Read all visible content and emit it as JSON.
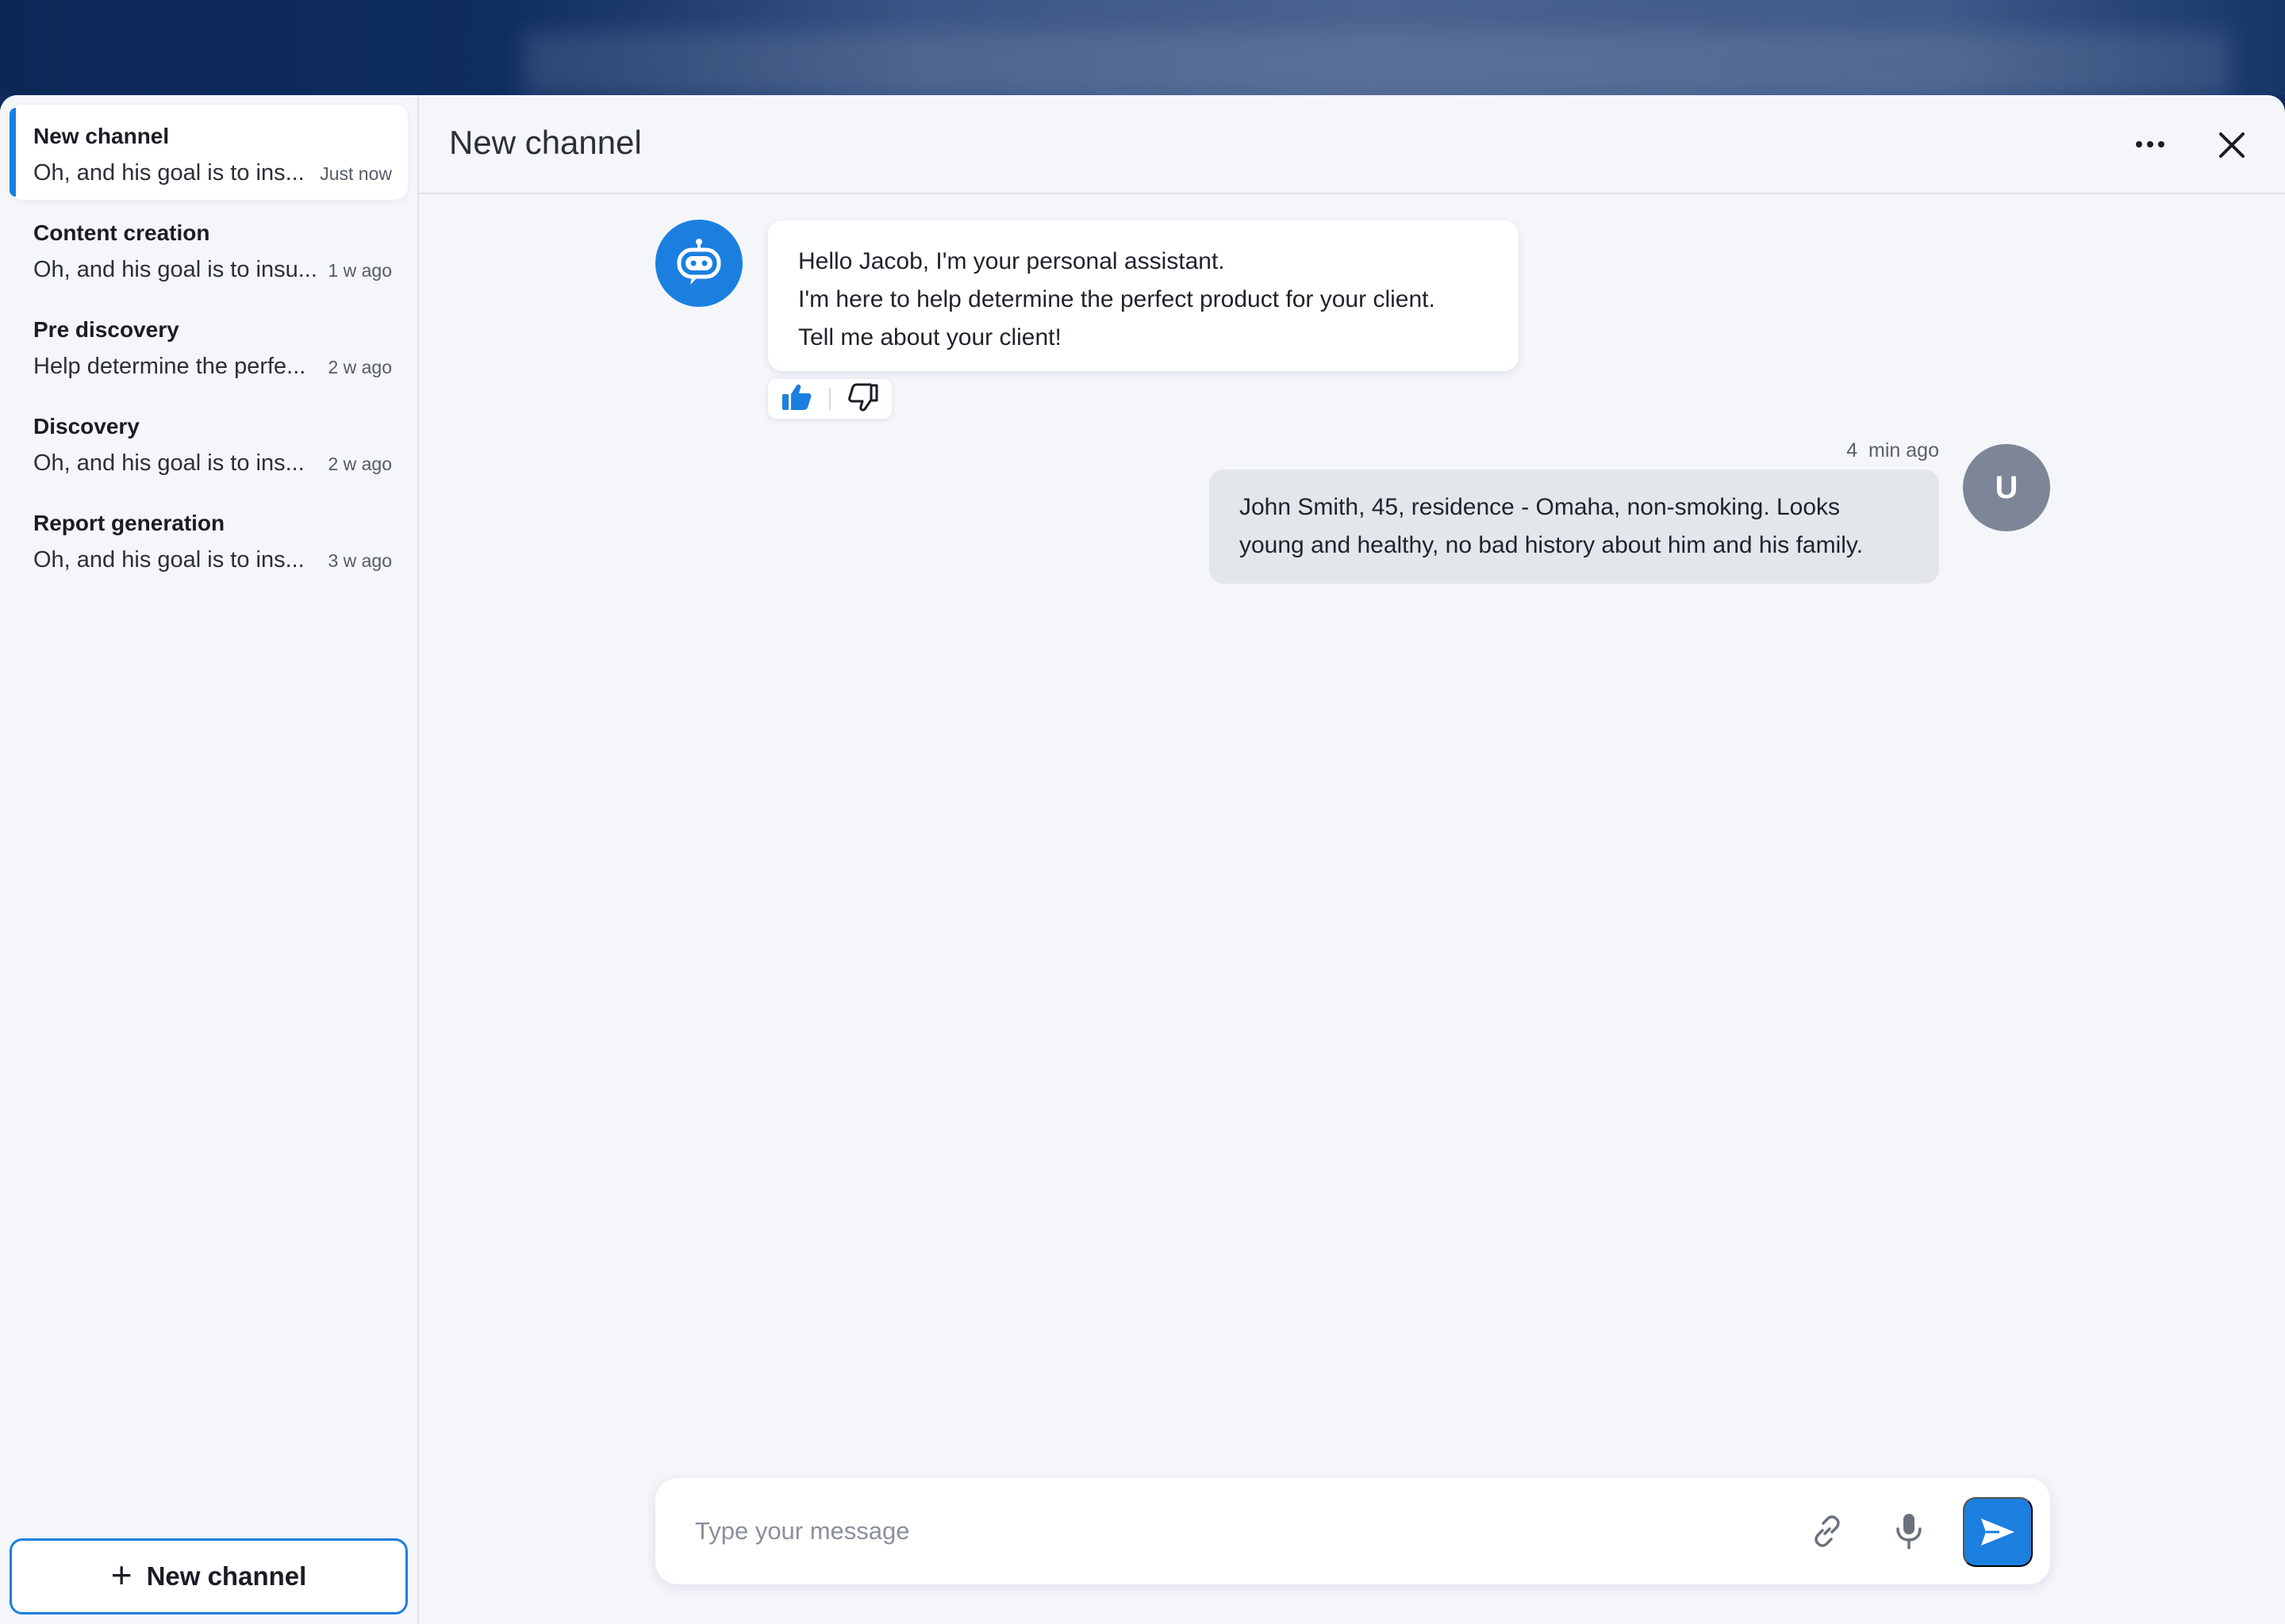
{
  "sidebar": {
    "conversations": [
      {
        "title": "New channel",
        "preview": "Oh, and his goal is to ins...",
        "time": "Just now"
      },
      {
        "title": "Content creation",
        "preview": "Oh, and his goal is to insu...",
        "time": "1 w ago"
      },
      {
        "title": "Pre discovery",
        "preview": "Help determine the perfe...",
        "time": "2 w ago"
      },
      {
        "title": "Discovery",
        "preview": "Oh, and his goal is to ins...",
        "time": "2 w ago"
      },
      {
        "title": "Report generation",
        "preview": "Oh, and his goal is to ins...",
        "time": "3 w ago"
      }
    ],
    "new_channel_label": "New channel"
  },
  "header": {
    "title": "New channel"
  },
  "messages": {
    "bot": {
      "lines": [
        "Hello Jacob, I'm your personal assistant.",
        "I'm here to help determine the perfect product for your client.",
        "Tell me about your client!"
      ]
    },
    "user": {
      "time": "4  min ago",
      "text": "John Smith, 45, residence - Omaha, non-smoking. Looks young and healthy, no bad history about him and his family.",
      "avatar_initial": "U"
    }
  },
  "composer": {
    "placeholder": "Type your message",
    "value": ""
  },
  "colors": {
    "accent": "#1b7fe0",
    "user_avatar": "#7d8697",
    "user_bubble": "#e3e6ea"
  }
}
